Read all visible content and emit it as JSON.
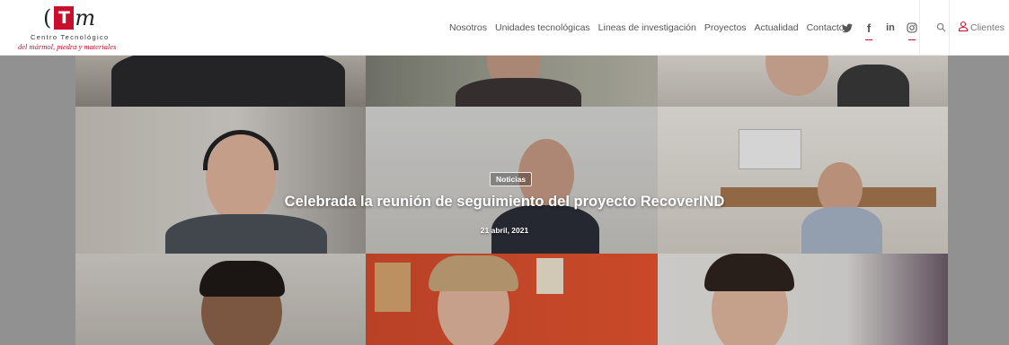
{
  "logo": {
    "paren": "(",
    "letter_t": "T",
    "letter_m": "m",
    "line1": "Centro Tecnológico",
    "line2": "del mármol, piedra y materiales"
  },
  "nav": {
    "items": [
      {
        "label": "Nosotros"
      },
      {
        "label": "Unidades tecnológicas"
      },
      {
        "label": "Lineas de investigación"
      },
      {
        "label": "Proyectos"
      },
      {
        "label": "Actualidad"
      },
      {
        "label": "Contacto"
      }
    ]
  },
  "social": {
    "icons": [
      "twitter-icon",
      "facebook-icon",
      "linkedin-icon",
      "instagram-icon"
    ],
    "facebook_glyph": "f",
    "linkedin_glyph": "in"
  },
  "header_actions": {
    "clients_label": "Clientes"
  },
  "hero": {
    "category": "Noticias",
    "title": "Celebrada la reunión de seguimiento del proyecto RecoverIND",
    "date": "21 abril, 2021"
  },
  "colors": {
    "brand_red": "#c8102e",
    "nav_text": "#555555",
    "hero_bg": "#a5a5a7"
  }
}
